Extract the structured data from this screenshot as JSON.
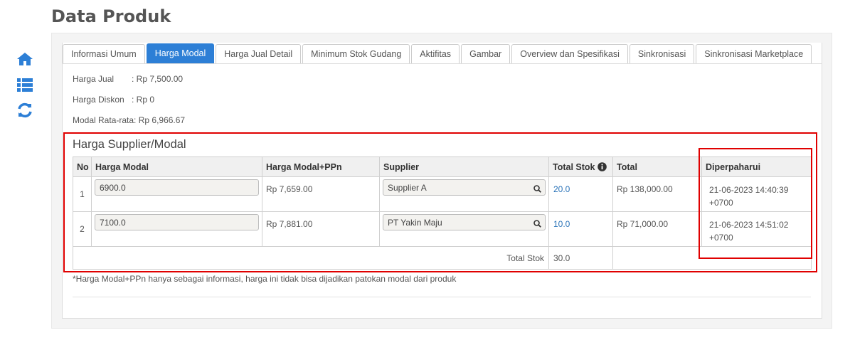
{
  "page": {
    "title": "Data Produk"
  },
  "sidebar": {
    "icons": [
      "home-icon",
      "list-icon",
      "refresh-icon"
    ]
  },
  "tabs": [
    {
      "label": "Informasi Umum",
      "active": false
    },
    {
      "label": "Harga Modal",
      "active": true
    },
    {
      "label": "Harga Jual Detail",
      "active": false
    },
    {
      "label": "Minimum Stok Gudang",
      "active": false
    },
    {
      "label": "Aktifitas",
      "active": false
    },
    {
      "label": "Gambar",
      "active": false
    },
    {
      "label": "Overview dan Spesifikasi",
      "active": false
    },
    {
      "label": "Sinkronisasi",
      "active": false
    },
    {
      "label": "Sinkronisasi Marketplace",
      "active": false
    }
  ],
  "info": {
    "harga_jual_label": "Harga Jual",
    "harga_jual_value": ": Rp 7,500.00",
    "harga_diskon_label": "Harga Diskon",
    "harga_diskon_value": ": Rp 0",
    "modal_label": "Modal Rata-rata:",
    "modal_value": "Rp 6,966.67"
  },
  "section": {
    "title": "Harga Supplier/Modal"
  },
  "table": {
    "headers": {
      "no": "No",
      "harga_modal": "Harga Modal",
      "harga_modal_ppn": "Harga Modal+PPn",
      "supplier": "Supplier",
      "total_stok": "Total Stok",
      "total": "Total",
      "diperbaharui": "Diperpaharui"
    },
    "rows": [
      {
        "no": "1",
        "harga_modal": "6900.0",
        "harga_modal_ppn": "Rp 7,659.00",
        "supplier": "Supplier A",
        "total_stok": "20.0",
        "total": "Rp 138,000.00",
        "date": "21-06-2023 14:40:39",
        "tz": "+0700"
      },
      {
        "no": "2",
        "harga_modal": "7100.0",
        "harga_modal_ppn": "Rp 7,881.00",
        "supplier": "PT Yakin Maju",
        "total_stok": "10.0",
        "total": "Rp 71,000.00",
        "date": "21-06-2023 14:51:02",
        "tz": "+0700"
      }
    ],
    "footer": {
      "label": "Total Stok",
      "value": "30.0"
    }
  },
  "footnote": "*Harga Modal+PPn hanya sebagai informasi, harga ini tidak bisa dijadikan patokan modal dari produk",
  "colors": {
    "accent": "#2d7fd6",
    "highlight": "#e00000",
    "link": "#2a73b8"
  }
}
